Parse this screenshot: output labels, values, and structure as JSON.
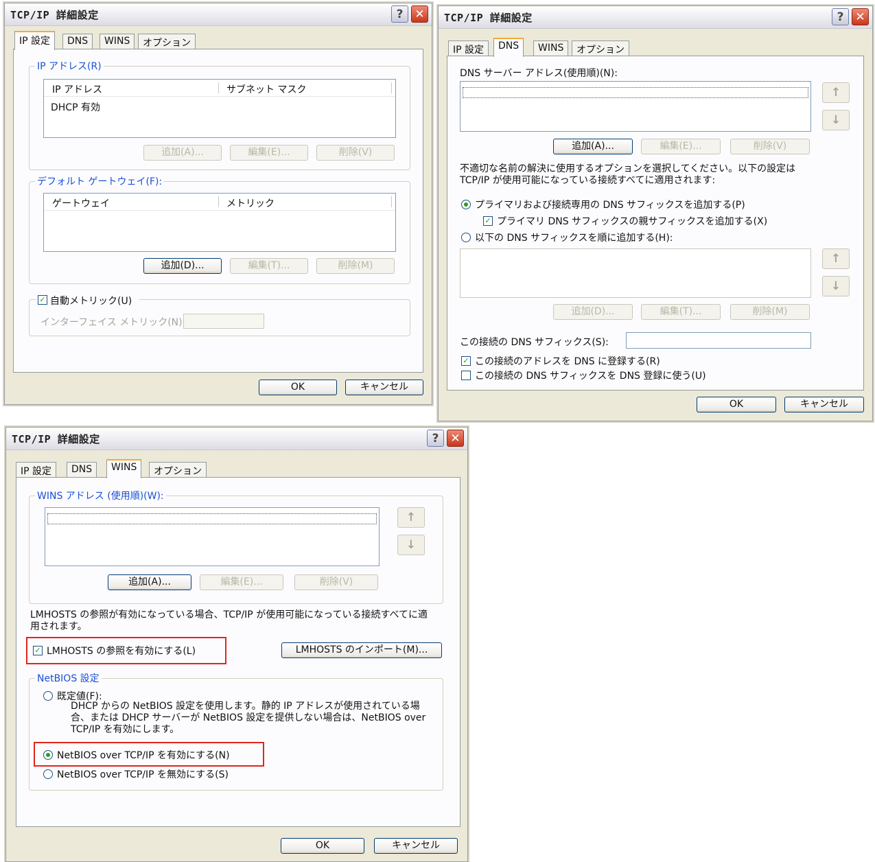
{
  "common": {
    "title": "TCP/IP 詳細設定",
    "help": "?",
    "close": "✕",
    "ok": "OK",
    "cancel": "キャンセル",
    "tabs": [
      "IP 設定",
      "DNS",
      "WINS",
      "オプション"
    ],
    "up_arrow": "↑",
    "down_arrow": "↓"
  },
  "ip": {
    "ip_group": "IP アドレス(R)",
    "col_ip": "IP アドレス",
    "col_mask": "サブネット マスク",
    "row": "DHCP 有効",
    "add": "追加(A)...",
    "edit": "編集(E)...",
    "delete": "削除(V)",
    "gw_group": "デフォルト ゲートウェイ(F):",
    "col_gw": "ゲートウェイ",
    "col_metric": "メトリック",
    "gw_add": "追加(D)...",
    "gw_edit": "編集(T)...",
    "gw_delete": "削除(M)",
    "auto_metric": "自動メトリック(U)",
    "auto_metric_checked": true,
    "iface_metric": "インターフェイス メトリック(N):",
    "iface_metric_value": ""
  },
  "dns": {
    "servers_label": "DNS サーバー アドレス(使用順)(N):",
    "add": "追加(A)...",
    "edit": "編集(E)...",
    "delete": "削除(V)",
    "desc": "不適切な名前の解決に使用するオプションを選択してください。以下の設定は TCP/IP が使用可能になっている接続すべてに適用されます:",
    "radio_primary": "プライマリおよび接続専用の DNS サフィックスを追加する(P)",
    "check_parent": "プライマリ DNS サフィックスの親サフィックスを追加する(X)",
    "radio_ordered": "以下の DNS サフィックスを順に追加する(H):",
    "add2": "追加(D)...",
    "edit2": "編集(T)...",
    "delete2": "削除(M)",
    "suffix_label": "この接続の DNS サフィックス(S):",
    "suffix_value": "",
    "register": "この接続のアドレスを DNS に登録する(R)",
    "use_suffix": "この接続の DNS サフィックスを DNS 登録に使う(U)"
  },
  "wins": {
    "group": "WINS アドレス (使用順)(W):",
    "add": "追加(A)...",
    "edit": "編集(E)...",
    "delete": "削除(V)",
    "desc": "LMHOSTS の参照が有効になっている場合、TCP/IP が使用可能になっている接続すべてに適用されます。",
    "lmhosts": "LMHOSTS の参照を有効にする(L)",
    "import": "LMHOSTS のインポート(M)...",
    "netbios_group": "NetBIOS 設定",
    "default": "既定値(F):",
    "default_desc": "DHCP からの NetBIOS 設定を使用します。静的 IP アドレスが使用されている場合、または DHCP サーバーが NetBIOS 設定を提供しない場合は、NetBIOS over TCP/IP を有効にします。",
    "enable": "NetBIOS over TCP/IP を有効にする(N)",
    "disable": "NetBIOS over TCP/IP を無効にする(S)"
  }
}
